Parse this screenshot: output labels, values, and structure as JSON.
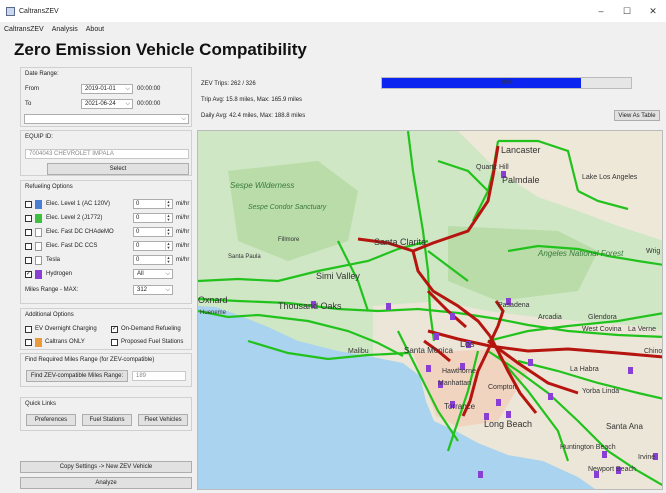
{
  "window": {
    "title": "CaltransZEV",
    "minimize": "–",
    "maximize": "☐",
    "close": "✕"
  },
  "menu": [
    "CaltransZEV",
    "Analysis",
    "About"
  ],
  "app_title": "Zero Emission Vehicle Compatibility",
  "date_range": {
    "heading": "Date Range:",
    "from_label": "From",
    "from_date": "2019-01-01",
    "from_time": "00:00:00",
    "to_label": "To",
    "to_date": "2021-06-24",
    "to_time": "00:00:00"
  },
  "equip": {
    "heading": "EQUIP ID:",
    "value": "7004043 CHEVROLET IMPALA",
    "select_label": "Select"
  },
  "refueling": {
    "heading": "Refueling Options",
    "options": [
      {
        "label": "Elec. Level 1 (AC 120V)",
        "value": "0",
        "unit": "mi/hr",
        "checked": false,
        "color": "#4a7fd4"
      },
      {
        "label": "Elec. Level 2 (J1772)",
        "value": "0",
        "unit": "mi/hr",
        "checked": false,
        "color": "#3fbf3f"
      },
      {
        "label": "Elec. Fast DC CHAdeMO",
        "value": "0",
        "unit": "mi/hr",
        "checked": false,
        "color": "#ffffff"
      },
      {
        "label": "Elec. Fast DC CCS",
        "value": "0",
        "unit": "mi/hr",
        "checked": false,
        "color": "#ffffff"
      },
      {
        "label": "Tesla",
        "value": "0",
        "unit": "mi/hr",
        "checked": false,
        "color": "#ffffff"
      },
      {
        "label": "Hydrogen",
        "value": "All",
        "unit": "",
        "checked": true,
        "color": "#8a3fd4"
      }
    ],
    "miles_range_label": "Miles Range - MAX:",
    "miles_range_value": "312"
  },
  "additional": {
    "heading": "Additional Options",
    "ev_overnight": "EV Overnight Charging",
    "on_demand": "On-Demand Refueling",
    "on_demand_checked": "✓",
    "caltrans_only": "Caltrans ONLY",
    "proposed": "Proposed Fuel Stations"
  },
  "find_range": {
    "heading": "Find Required Miles Range (for ZEV-compatible)",
    "button": "Find ZEV-compatible Miles Range:",
    "value": "189"
  },
  "quick_links": {
    "heading": "Quick Links",
    "preferences": "Preferences",
    "fuel_stations": "Fuel Stations",
    "fleet_vehicles": "Fleet Vehicles"
  },
  "bottom": {
    "copy_settings": "Copy Settings -> New ZEV Vehicle",
    "analyze": "Analyze"
  },
  "stats": {
    "zev_trips": "ZEV Trips: 262 / 326",
    "trip_avg": "Trip Avg: 15.8 miles, Max: 165.9 miles",
    "daily_avg": "Daily Avg: 42.4 miles, Max: 188.8 miles",
    "progress_percent": 80,
    "progress_text": "80%",
    "view_table": "View As Table"
  },
  "map": {
    "labels": {
      "lancaster": "Lancaster",
      "quartz_hill": "Quartz Hill",
      "palmdale": "Palmdale",
      "lake_los_angeles": "Lake Los Angeles",
      "sespe_wilderness": "Sespe Wilderness",
      "sespe_condor": "Sespe Condor Sanctuary",
      "fillmore": "Fillmore",
      "santa_clarita": "Santa Clarita",
      "santa_paula": "Santa Paula",
      "angeles": "Angeles National Forest",
      "simi_valley": "Simi Valley",
      "oxnard": "Oxnard",
      "thousand_oaks": "Thousand Oaks",
      "hueneme": "Hueneme",
      "pasadena": "Pasadena",
      "arcadia": "Arcadia",
      "glendora": "Glendora",
      "west_covina": "West Covina",
      "la_verne": "La Verne",
      "malibu": "Malibu",
      "santa_monica": "Santa Monica",
      "los_angeles": "Los",
      "la_habra": "La Habra",
      "hawthorne": "Hawthorne",
      "compton": "Compton",
      "torrance": "Torrance",
      "yorba_linda": "Yorba Linda",
      "long_beach": "Long Beach",
      "santa_ana": "Santa Ana",
      "huntington_beach": "Huntington Beach",
      "newport_beach": "Newport Beach",
      "wrig": "Wrig",
      "chino": "Chino",
      "irvine": "Irvine",
      "manhattan": "Manhattan"
    }
  }
}
